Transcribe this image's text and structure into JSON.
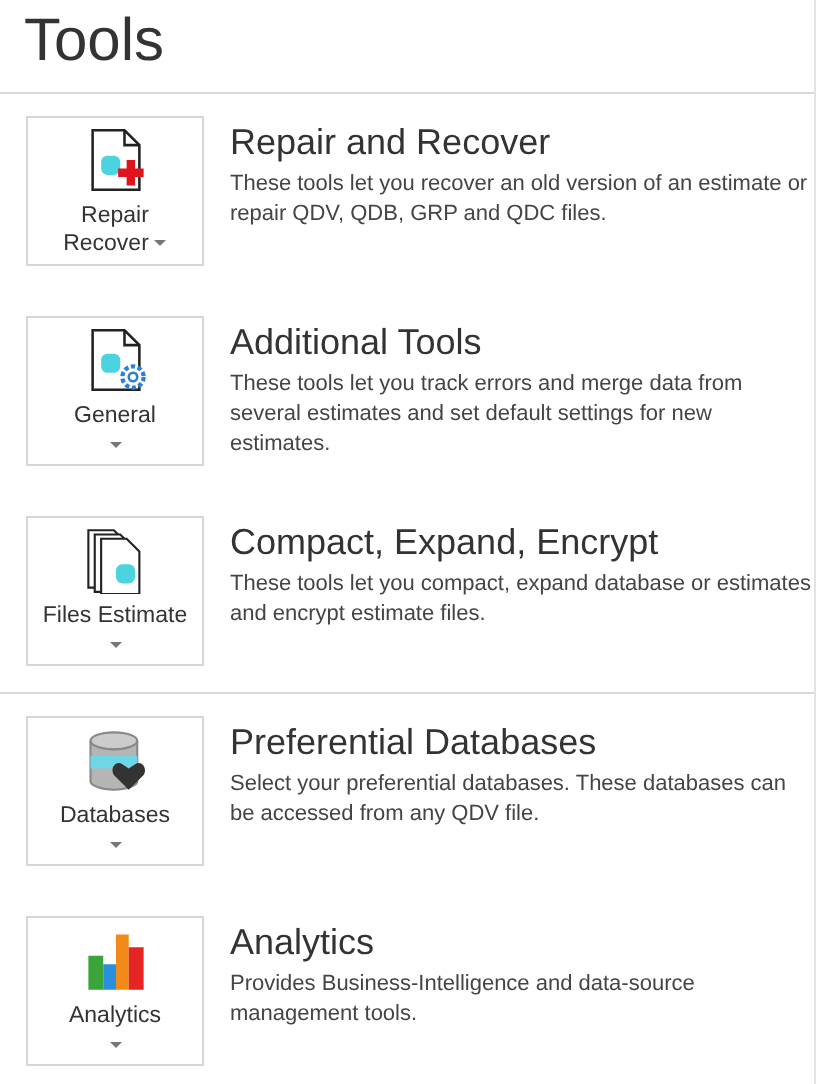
{
  "title": "Tools",
  "groups": [
    {
      "items": [
        {
          "kind": "repair",
          "button_lines": [
            "Repair",
            "Recover"
          ],
          "heading": "Repair and Recover",
          "description": "These tools let you recover an old version of an estimate or repair QDV, QDB, GRP and QDC files."
        },
        {
          "kind": "general",
          "button_lines": [
            "General"
          ],
          "heading": "Additional Tools",
          "description": "These tools let you track errors and merge data from several estimates and set default settings for new estimates."
        },
        {
          "kind": "files",
          "button_lines": [
            "Files Estimate"
          ],
          "heading": "Compact, Expand, Encrypt",
          "description": "These tools let you compact, expand database or estimates and encrypt estimate files."
        }
      ]
    },
    {
      "items": [
        {
          "kind": "databases",
          "button_lines": [
            "Databases"
          ],
          "heading": "Preferential Databases",
          "description": "Select your preferential databases. These databases can be accessed from any QDV file."
        },
        {
          "kind": "analytics",
          "button_lines": [
            "Analytics"
          ],
          "heading": "Analytics",
          "description": "Provides Business-Intelligence and data-source management tools."
        }
      ]
    }
  ]
}
